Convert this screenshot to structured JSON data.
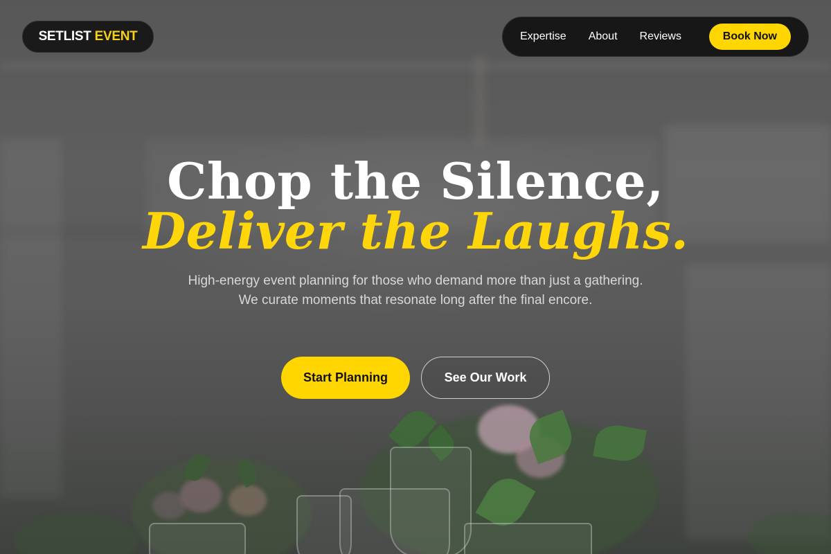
{
  "nav": {
    "logo_part1": "SETLIST",
    "logo_part2": "EVENT",
    "links": [
      "Expertise",
      "About",
      "Reviews"
    ],
    "cta_label": "Book Now"
  },
  "hero": {
    "headline_line1": "Chop the Silence,",
    "headline_line2": "Deliver the Laughs.",
    "subtext": "High-energy event planning for those who demand more than just a gathering. We curate moments that resonate long after the final encore.",
    "primary_button": "Start Planning",
    "secondary_button": "See Our Work"
  },
  "colors": {
    "accent": "#ffd600",
    "nav_background": "#171717",
    "headline_white": "#ffffff"
  }
}
